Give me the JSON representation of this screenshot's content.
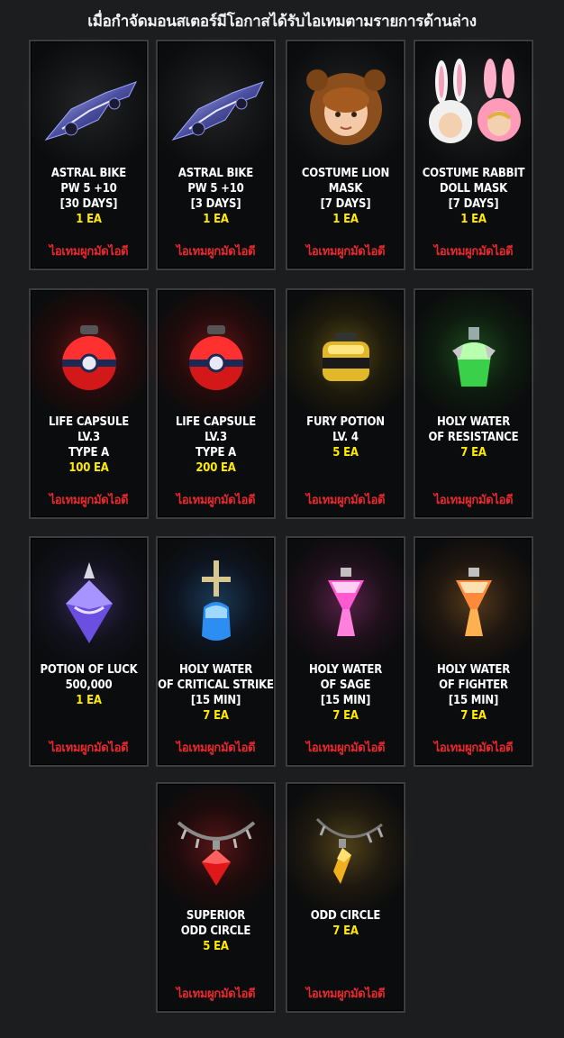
{
  "header": {
    "title": "เมื่อกำจัดมอนสเตอร์มีโอกาสได้รับไอเทมตามรายการด้านล่าง"
  },
  "items": [
    {
      "name": "ASTRAL BIKE\nPW 5 +10\n[30 DAYS]",
      "qty": "1 EA",
      "bind": "ไอเทมผูกมัดไอดี",
      "icon": "astral-bike-icon"
    },
    {
      "name": "ASTRAL BIKE\nPW 5 +10\n[3 DAYS]",
      "qty": "1 EA",
      "bind": "ไอเทมผูกมัดไอดี",
      "icon": "astral-bike-icon"
    },
    {
      "name": "COSTUME LION\nMASK\n[7 DAYS]",
      "qty": "1 EA",
      "bind": "ไอเทมผูกมัดไอดี",
      "icon": "lion-mask-icon"
    },
    {
      "name": "COSTUME RABBIT\nDOLL MASK\n[7 DAYS]",
      "qty": "1 EA",
      "bind": "ไอเทมผูกมัดไอดี",
      "icon": "rabbit-mask-icon"
    },
    {
      "name": "LIFE CAPSULE\nLV.3\nTYPE A",
      "qty": "100 EA",
      "bind": "ไอเทมผูกมัดไอดี",
      "icon": "life-capsule-icon"
    },
    {
      "name": "LIFE CAPSULE\nLV.3\nTYPE A",
      "qty": "200 EA",
      "bind": "ไอเทมผูกมัดไอดี",
      "icon": "life-capsule-icon"
    },
    {
      "name": "FURY POTION\nLV. 4",
      "qty": "5 EA",
      "bind": "ไอเทมผูกมัดไอดี",
      "icon": "fury-potion-icon"
    },
    {
      "name": "HOLY WATER\nOF RESISTANCE",
      "qty": "7 EA",
      "bind": "ไอเทมผูกมัดไอดี",
      "icon": "holy-water-resistance-icon"
    },
    {
      "name": "POTION OF LUCK\n500,000",
      "qty": "1 EA",
      "bind": "ไอเทมผูกมัดไอดี",
      "icon": "potion-of-luck-icon"
    },
    {
      "name": "HOLY WATER\nOF CRITICAL STRIKE\n[15 MIN]",
      "qty": "7 EA",
      "bind": "ไอเทมผูกมัดไอดี",
      "icon": "holy-water-critical-icon"
    },
    {
      "name": "HOLY WATER\nOF SAGE\n[15 MIN]",
      "qty": "7 EA",
      "bind": "ไอเทมผูกมัดไอดี",
      "icon": "holy-water-sage-icon"
    },
    {
      "name": "HOLY WATER\nOF FIGHTER\n[15 MIN]",
      "qty": "7 EA",
      "bind": "ไอเทมผูกมัดไอดี",
      "icon": "holy-water-fighter-icon"
    },
    {
      "name": "SUPERIOR\nODD CIRCLE",
      "qty": "5 EA",
      "bind": "ไอเทมผูกมัดไอดี",
      "icon": "superior-odd-circle-icon"
    },
    {
      "name": "ODD CIRCLE",
      "qty": "7 EA",
      "bind": "ไอเทมผูกมัดไอดี",
      "icon": "odd-circle-icon"
    }
  ]
}
